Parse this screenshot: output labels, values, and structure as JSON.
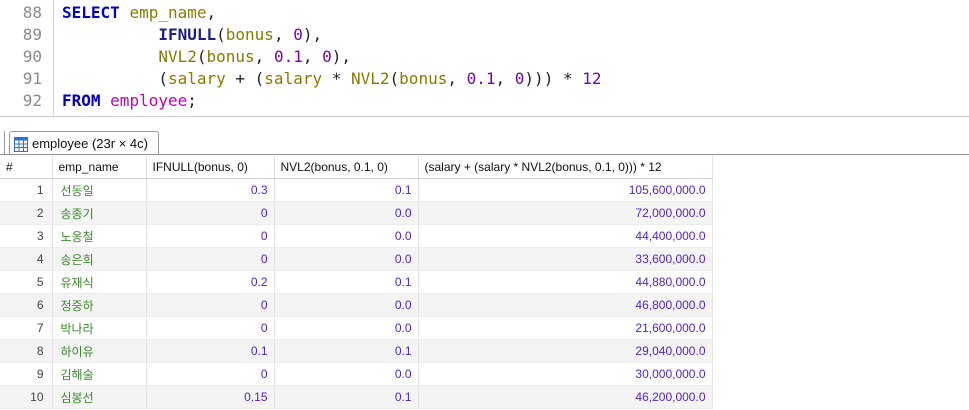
{
  "editor": {
    "lines": [
      {
        "num": "88",
        "parts": [
          {
            "c": "kw",
            "t": "SELECT"
          },
          {
            "c": "op",
            "t": " "
          },
          {
            "c": "id",
            "t": "emp_name"
          },
          {
            "c": "op",
            "t": ","
          }
        ]
      },
      {
        "num": "89",
        "parts": [
          {
            "c": "op",
            "t": "          "
          },
          {
            "c": "fn",
            "t": "IFNULL"
          },
          {
            "c": "op",
            "t": "("
          },
          {
            "c": "id",
            "t": "bonus"
          },
          {
            "c": "op",
            "t": ", "
          },
          {
            "c": "num",
            "t": "0"
          },
          {
            "c": "op",
            "t": "),"
          }
        ]
      },
      {
        "num": "90",
        "parts": [
          {
            "c": "op",
            "t": "          "
          },
          {
            "c": "id",
            "t": "NVL2"
          },
          {
            "c": "op",
            "t": "("
          },
          {
            "c": "id",
            "t": "bonus"
          },
          {
            "c": "op",
            "t": ", "
          },
          {
            "c": "num",
            "t": "0.1"
          },
          {
            "c": "op",
            "t": ", "
          },
          {
            "c": "num",
            "t": "0"
          },
          {
            "c": "op",
            "t": "),"
          }
        ]
      },
      {
        "num": "91",
        "parts": [
          {
            "c": "op",
            "t": "          ("
          },
          {
            "c": "id",
            "t": "salary"
          },
          {
            "c": "op",
            "t": " + ("
          },
          {
            "c": "id",
            "t": "salary"
          },
          {
            "c": "op",
            "t": " * "
          },
          {
            "c": "id",
            "t": "NVL2"
          },
          {
            "c": "op",
            "t": "("
          },
          {
            "c": "id",
            "t": "bonus"
          },
          {
            "c": "op",
            "t": ", "
          },
          {
            "c": "num",
            "t": "0.1"
          },
          {
            "c": "op",
            "t": ", "
          },
          {
            "c": "num",
            "t": "0"
          },
          {
            "c": "op",
            "t": "))) * "
          },
          {
            "c": "num",
            "t": "12"
          }
        ]
      },
      {
        "num": "92",
        "parts": [
          {
            "c": "kw",
            "t": "FROM"
          },
          {
            "c": "op",
            "t": " "
          },
          {
            "c": "pk",
            "t": "employee"
          },
          {
            "c": "op",
            "t": ";"
          }
        ]
      }
    ]
  },
  "tab": {
    "label": "employee (23r × 4c)",
    "icon": "table-grid-icon",
    "icon_color": "#2f6fd0"
  },
  "grid": {
    "columns": [
      "#",
      "emp_name",
      "IFNULL(bonus, 0)",
      "NVL2(bonus, 0.1, 0)",
      "(salary + (salary * NVL2(bonus, 0.1, 0))) * 12"
    ],
    "rows": [
      [
        "1",
        "선동일",
        "0.3",
        "0.1",
        "105,600,000.0"
      ],
      [
        "2",
        "송종기",
        "0",
        "0.0",
        "72,000,000.0"
      ],
      [
        "3",
        "노옹철",
        "0",
        "0.0",
        "44,400,000.0"
      ],
      [
        "4",
        "송은희",
        "0",
        "0.0",
        "33,600,000.0"
      ],
      [
        "5",
        "유재식",
        "0.2",
        "0.1",
        "44,880,000.0"
      ],
      [
        "6",
        "정중하",
        "0",
        "0.0",
        "46,800,000.0"
      ],
      [
        "7",
        "박나라",
        "0",
        "0.0",
        "21,600,000.0"
      ],
      [
        "8",
        "하이유",
        "0.1",
        "0.1",
        "29,040,000.0"
      ],
      [
        "9",
        "김해술",
        "0",
        "0.0",
        "30,000,000.0"
      ],
      [
        "10",
        "심봉선",
        "0.15",
        "0.1",
        "46,200,000.0"
      ]
    ]
  }
}
